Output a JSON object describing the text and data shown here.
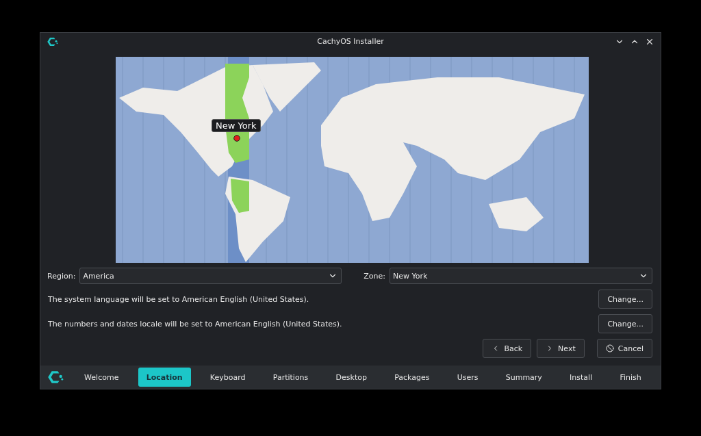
{
  "window": {
    "title": "CachyOS Installer"
  },
  "map": {
    "marker_label": "New York"
  },
  "region": {
    "label": "Region:",
    "value": "America"
  },
  "zone": {
    "label": "Zone:",
    "value": "New York"
  },
  "locale_rows": [
    {
      "text": "The system language will be set to American English (United States).",
      "button": "Change..."
    },
    {
      "text": "The numbers and dates locale will be set to American English (United States).",
      "button": "Change..."
    }
  ],
  "buttons": [
    {
      "kind": "back",
      "label": "Back"
    },
    {
      "kind": "next",
      "label": "Next"
    },
    {
      "kind": "cancel",
      "label": "Cancel"
    }
  ],
  "steps": [
    {
      "label": "Welcome",
      "selected": false
    },
    {
      "label": "Location",
      "selected": true
    },
    {
      "label": "Keyboard",
      "selected": false
    },
    {
      "label": "Partitions",
      "selected": false
    },
    {
      "label": "Desktop",
      "selected": false
    },
    {
      "label": "Packages",
      "selected": false
    },
    {
      "label": "Users",
      "selected": false
    },
    {
      "label": "Summary",
      "selected": false
    },
    {
      "label": "Install",
      "selected": false
    },
    {
      "label": "Finish",
      "selected": false
    }
  ]
}
